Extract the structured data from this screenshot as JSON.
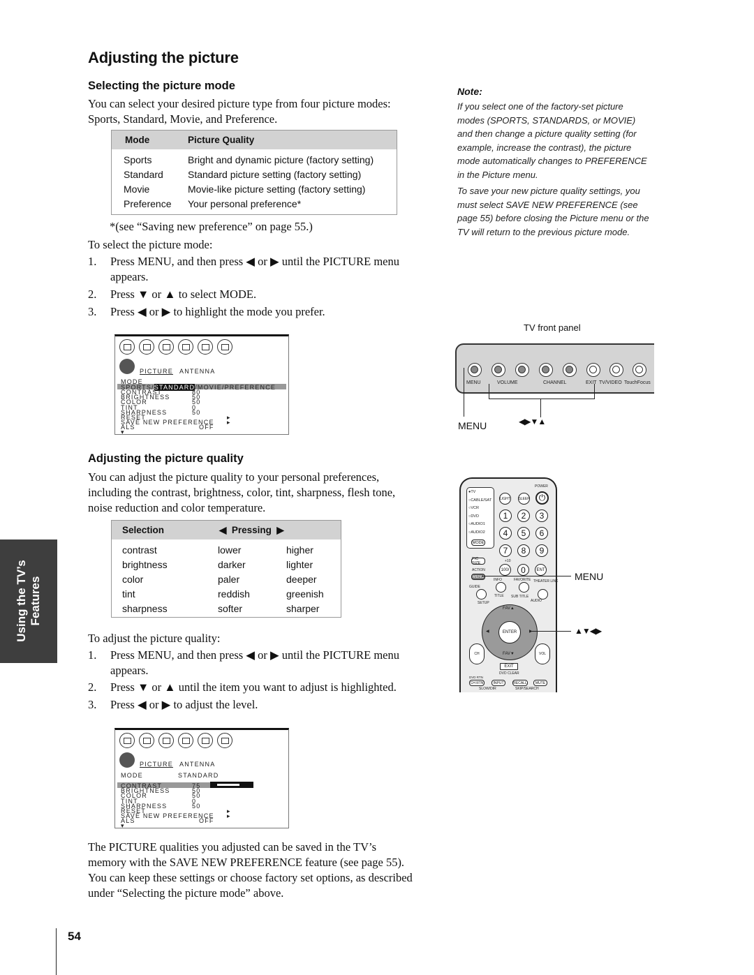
{
  "page": {
    "title": "Adjusting the picture",
    "page_number": "54",
    "side_tab": {
      "line1": "Using the TV’s",
      "line2": "Features"
    }
  },
  "section_mode": {
    "heading": "Selecting the picture mode",
    "intro_line1": "You can select your desired picture type from four picture modes:",
    "intro_line2": "Sports, Standard, Movie, and Preference.",
    "table": {
      "headers": [
        "Mode",
        "Picture Quality"
      ],
      "rows": [
        [
          "Sports",
          "Bright and dynamic picture (factory setting)"
        ],
        [
          "Standard",
          "Standard picture setting (factory setting)"
        ],
        [
          "Movie",
          "Movie-like picture setting (factory setting)"
        ],
        [
          "Preference",
          "Your personal preference*"
        ]
      ]
    },
    "footnote": "*(see “Saving new preference” on page 55.)",
    "lead": "To select the picture mode:",
    "steps": [
      {
        "num": "1.",
        "text": "Press MENU, and then press ◀ or ▶ until the PICTURE menu appears."
      },
      {
        "num": "2.",
        "text": "Press ▼ or ▲ to select MODE."
      },
      {
        "num": "3.",
        "text": "Press ◀ or ▶ to highlight the mode you prefer."
      }
    ],
    "osd": {
      "tab_label": "PICTURE",
      "tab_label2": "ANTENNA",
      "mode_label": "MODE",
      "mode_options_prefix": "SPORTS/",
      "mode_selected": "STANDARD",
      "mode_options_suffix": "/MOVIE/PREFERENCE",
      "items": [
        {
          "label": "CONTRAST",
          "value": "80"
        },
        {
          "label": "BRIGHTNESS",
          "value": "50"
        },
        {
          "label": "COLOR",
          "value": "50"
        },
        {
          "label": "TINT",
          "value": "0"
        },
        {
          "label": "SHARPNESS",
          "value": "50"
        },
        {
          "label": "RESET",
          "value": "▸"
        },
        {
          "label": "SAVE NEW PREFERENCE",
          "value": "▸"
        },
        {
          "label": "ALS",
          "value": "OFF"
        }
      ],
      "more_arrow": "▾"
    }
  },
  "section_quality": {
    "heading": "Adjusting the picture quality",
    "intro": [
      "You can adjust the picture quality to your personal preferences,",
      "including the contrast, brightness, color, tint, sharpness, flesh tone,",
      "noise reduction and color temperature."
    ],
    "table": {
      "header_selection": "Selection",
      "header_pressing": "◀  Pressing  ▶",
      "rows": [
        [
          "contrast",
          "lower",
          "higher"
        ],
        [
          "brightness",
          "darker",
          "lighter"
        ],
        [
          "color",
          "paler",
          "deeper"
        ],
        [
          "tint",
          "reddish",
          "greenish"
        ],
        [
          "sharpness",
          "softer",
          "sharper"
        ]
      ]
    },
    "lead": "To adjust the picture quality:",
    "steps": [
      {
        "num": "1.",
        "text": "Press MENU, and then press ◀ or ▶ until the PICTURE menu appears."
      },
      {
        "num": "2.",
        "text": "Press ▼ or ▲ until the item you want to adjust is highlighted."
      },
      {
        "num": "3.",
        "text": "Press ◀ or ▶ to adjust the level."
      }
    ],
    "osd": {
      "tab_label": "PICTURE",
      "tab_label2": "ANTENNA",
      "mode_label": "MODE",
      "mode_value": "STANDARD",
      "items": [
        {
          "label": "CONTRAST",
          "value": "75"
        },
        {
          "label": "BRIGHTNESS",
          "value": "50"
        },
        {
          "label": "COLOR",
          "value": "50"
        },
        {
          "label": "TINT",
          "value": "0"
        },
        {
          "label": "SHARPNESS",
          "value": "50"
        },
        {
          "label": "RESET",
          "value": "▸"
        },
        {
          "label": "SAVE NEW PREFERENCE",
          "value": "▸"
        },
        {
          "label": "ALS",
          "value": "OFF"
        }
      ],
      "contrast_slider_fraction": 0.75,
      "more_arrow": "▾"
    },
    "closing": [
      "The PICTURE qualities you adjusted can be saved in the TV’s",
      "memory with the SAVE NEW PREFERENCE feature (see page 55).",
      "You can keep these settings or choose factory set options, as described",
      "under “Selecting the picture mode” above."
    ]
  },
  "note": {
    "title": "Note:",
    "para1": "If you select one of the factory-set picture modes (SPORTS, STANDARDS, or MOVIE) and then change a picture quality setting (for example, increase the contrast), the picture mode automatically changes to PREFERENCE in the Picture menu.",
    "para2": "To save your new picture quality settings, you must select SAVE NEW PREFERENCE (see page 55) before closing the Picture menu or the TV will return to the previous picture mode."
  },
  "front_panel": {
    "caption": "TV front panel",
    "labels": [
      "MENU",
      "VOLUME",
      "CHANNEL",
      "EXIT",
      "TV/VIDEO",
      "TouchFocus"
    ],
    "callout_menu": "MENU",
    "callout_arrows": "◀▶▼▲"
  },
  "remote": {
    "power": "POWER",
    "modes": [
      "●TV",
      "○CABLE/SAT",
      "○VCR",
      "○DVD",
      "○AUDIO1",
      "○AUDIO2"
    ],
    "mode_button": "MODE",
    "light": "LIGHT",
    "sleep": "SLEEP",
    "digits": [
      "1",
      "2",
      "3",
      "4",
      "5",
      "6",
      "7",
      "8",
      "9"
    ],
    "pic_size": "PIC SIZE",
    "plus10": "+10",
    "hundred": "100/",
    "zero": "0",
    "ent": "ENT",
    "action": "ACTION",
    "menu": "MENU",
    "info": "INFO",
    "favorite": "FAVORITE",
    "theater_link": "THEATER LINK",
    "guide": "GUIDE",
    "title": "TITLE",
    "sub_title": "SUB TITLE",
    "setup": "SETUP",
    "audio": "AUDIO",
    "fav_up": "FAV▲",
    "fav_down": "FAV▼",
    "enter": "ENTER",
    "ch": "CH",
    "vol": "VOL",
    "exit": "EXIT",
    "dvd_clear": "DVD CLEAR",
    "dvd_rtn": "DVD RTN",
    "ch_rtn": "CH RTN",
    "input": "INPUT",
    "recall": "RECALL",
    "mute": "MUTE",
    "slow_dir": "SLOW/DIR",
    "skip_search": "SKIP/SEARCH",
    "callout_menu": "MENU",
    "callout_arrows": "▲▼◀▶"
  }
}
